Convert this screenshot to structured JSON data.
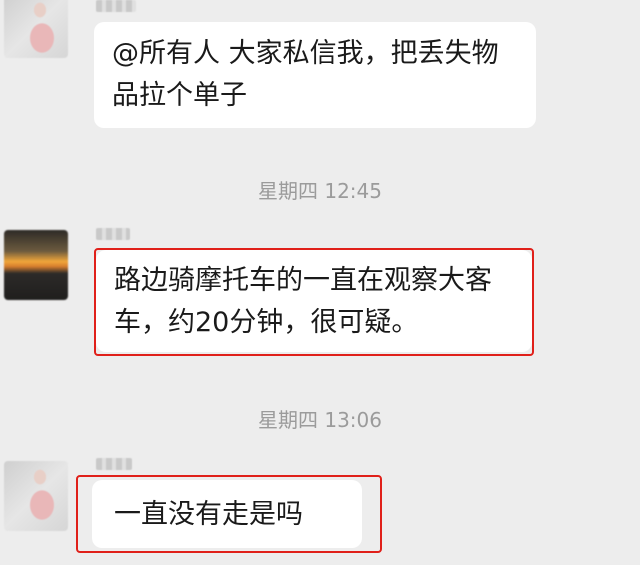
{
  "messages": [
    {
      "text": "@所有人 大家私信我，把丢失物品拉个单子"
    },
    {
      "text": "路边骑摩托车的一直在观察大客车，约20分钟，很可疑。"
    },
    {
      "text": "一直没有走是吗"
    }
  ],
  "timestamps": [
    "星期四 12:45",
    "星期四 13:06"
  ],
  "highlight_color": "#e0201a",
  "bubble_color": "#ffffff",
  "background_color": "#ededed"
}
